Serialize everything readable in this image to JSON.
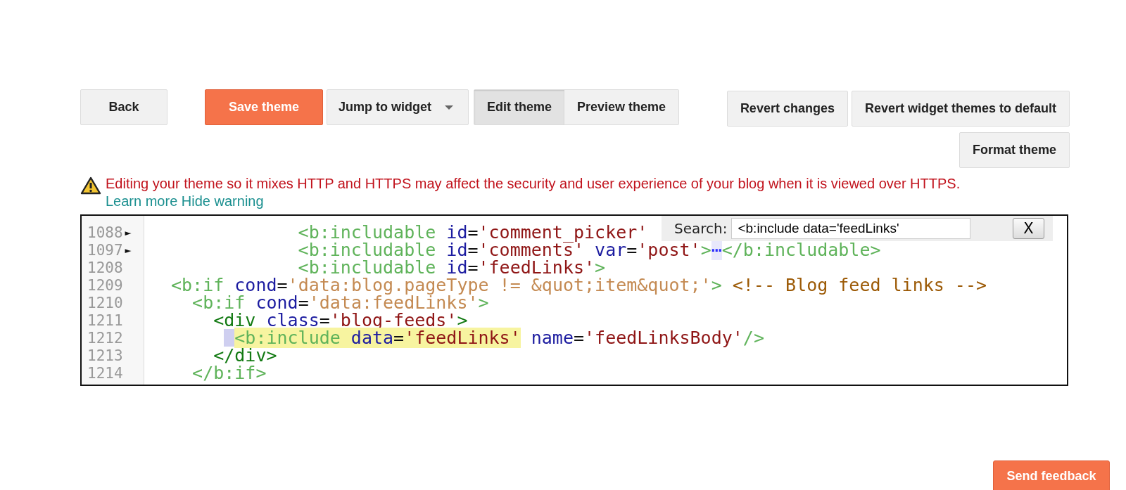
{
  "toolbar": {
    "back": "Back",
    "save": "Save theme",
    "jump": {
      "label": "Jump to widget"
    },
    "view_tabs": [
      {
        "label": "Edit theme",
        "selected": true
      },
      {
        "label": "Preview theme",
        "selected": false
      }
    ],
    "right_buttons": [
      "Revert changes",
      "Revert widget themes to default",
      "Format theme"
    ]
  },
  "warning": {
    "text": "Editing your theme so it mixes HTTP and HTTPS may affect the security and user experience of your blog when it is viewed over HTTPS.",
    "links": [
      "Learn more",
      "Hide warning"
    ]
  },
  "editor": {
    "lines": [
      {
        "number": "1088",
        "fold_marker": "►",
        "tokens": [
          {
            "kind": "btag",
            "text": "            <b:includable"
          },
          {
            "kind": "attr",
            "text": " id"
          },
          {
            "kind": "eq",
            "text": "="
          },
          {
            "kind": "value",
            "text": "'comment_picker'"
          }
        ]
      },
      {
        "number": "1097",
        "fold_marker": "►",
        "tokens": [
          {
            "kind": "btag",
            "text": "            <b:includable"
          },
          {
            "kind": "attr",
            "text": " id"
          },
          {
            "kind": "eq",
            "text": "="
          },
          {
            "kind": "value",
            "text": "'comments'"
          },
          {
            "kind": "attr",
            "text": " var"
          },
          {
            "kind": "eq",
            "text": "="
          },
          {
            "kind": "value",
            "text": "'post'"
          },
          {
            "kind": "btag",
            "text": ">"
          },
          {
            "kind": "fold",
            "text": "⋯"
          },
          {
            "kind": "btag",
            "text": "</b:includable>"
          }
        ]
      },
      {
        "number": "1208",
        "tokens": [
          {
            "kind": "btag",
            "text": "            <b:includable"
          },
          {
            "kind": "attr",
            "text": " id"
          },
          {
            "kind": "eq",
            "text": "="
          },
          {
            "kind": "value",
            "text": "'feedLinks'"
          },
          {
            "kind": "btag",
            "text": ">"
          }
        ]
      },
      {
        "number": "1209",
        "tokens": [
          {
            "kind": "btag",
            "text": "<b:if"
          },
          {
            "kind": "attr",
            "text": " cond"
          },
          {
            "kind": "eq",
            "text": "="
          },
          {
            "kind": "expr",
            "text": "'data:blog.pageType != &quot;item&quot;'"
          },
          {
            "kind": "btag",
            "text": ">"
          },
          {
            "kind": "comment",
            "text": " <!-- Blog feed links -->"
          }
        ]
      },
      {
        "number": "1210",
        "tokens": [
          {
            "kind": "btag",
            "text": "  <b:if"
          },
          {
            "kind": "attr",
            "text": " cond"
          },
          {
            "kind": "eq",
            "text": "="
          },
          {
            "kind": "expr",
            "text": "'data:feedLinks'"
          },
          {
            "kind": "btag",
            "text": ">"
          }
        ]
      },
      {
        "number": "1211",
        "tokens": [
          {
            "kind": "htag",
            "text": "    <div"
          },
          {
            "kind": "attr",
            "text": " class"
          },
          {
            "kind": "eq",
            "text": "="
          },
          {
            "kind": "value",
            "text": "'blog-feeds'"
          },
          {
            "kind": "htag",
            "text": ">"
          }
        ]
      },
      {
        "number": "1212",
        "selection_marker": true,
        "tokens": [
          {
            "kind": "btag",
            "text": "<b:include",
            "highlighted": true
          },
          {
            "kind": "attr",
            "text": " data",
            "highlighted": true
          },
          {
            "kind": "eq",
            "text": "=",
            "highlighted": true
          },
          {
            "kind": "value",
            "text": "'feedLinks'",
            "highlighted": true
          },
          {
            "kind": "attr",
            "text": " name"
          },
          {
            "kind": "eq",
            "text": "="
          },
          {
            "kind": "value",
            "text": "'feedLinksBody'"
          },
          {
            "kind": "btag",
            "text": "/>"
          }
        ]
      },
      {
        "number": "1213",
        "tokens": [
          {
            "kind": "htag",
            "text": "    </div>"
          }
        ]
      },
      {
        "number": "1214",
        "tokens": [
          {
            "kind": "btag",
            "text": "  </b:if>"
          }
        ]
      }
    ],
    "search": {
      "label": "Search:",
      "value": "<b:include data='feedLinks'",
      "close": "X"
    }
  },
  "feedback": "Send feedback"
}
